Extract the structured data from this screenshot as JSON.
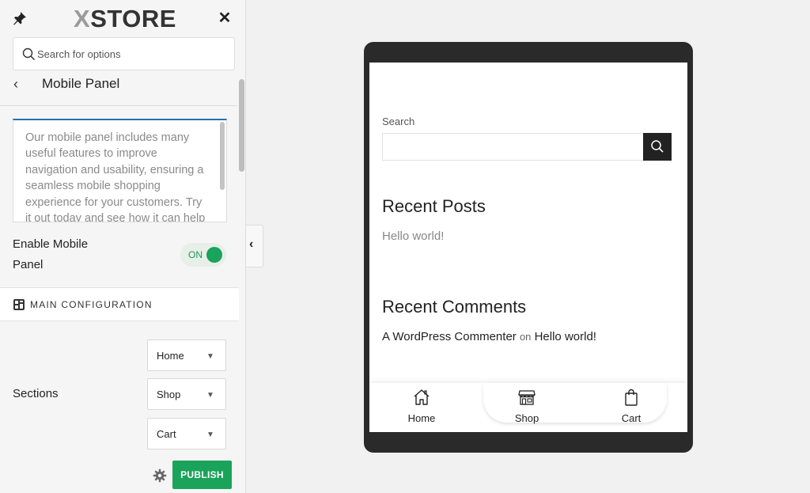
{
  "brand": {
    "logo_text": "XSTORE"
  },
  "search": {
    "placeholder": "Search for options"
  },
  "panel": {
    "title": "Mobile Panel",
    "description": "Our mobile panel includes many useful features to improve navigation and usability, ensuring a seamless mobile shopping experience for your customers. Try it out today and see how it can help",
    "enable_label": "Enable Mobile Panel",
    "toggle_state": "ON",
    "section_header": "MAIN CONFIGURATION",
    "sections_label": "Sections",
    "sections": [
      {
        "value": "Home"
      },
      {
        "value": "Shop"
      },
      {
        "value": "Cart"
      }
    ],
    "publish_label": "PUBLISH"
  },
  "preview": {
    "search_label": "Search",
    "recent_posts_title": "Recent Posts",
    "recent_post": "Hello world!",
    "recent_comments_title": "Recent Comments",
    "comment_author": "A WordPress Commenter",
    "comment_on": "on",
    "comment_post": "Hello world!",
    "nav": [
      {
        "label": "Home",
        "icon": "home-icon"
      },
      {
        "label": "Shop",
        "icon": "shop-icon"
      },
      {
        "label": "Cart",
        "icon": "cart-icon"
      }
    ]
  },
  "colors": {
    "accent": "#1aa35a",
    "focus": "#2271b1",
    "device": "#2a2a2a"
  }
}
